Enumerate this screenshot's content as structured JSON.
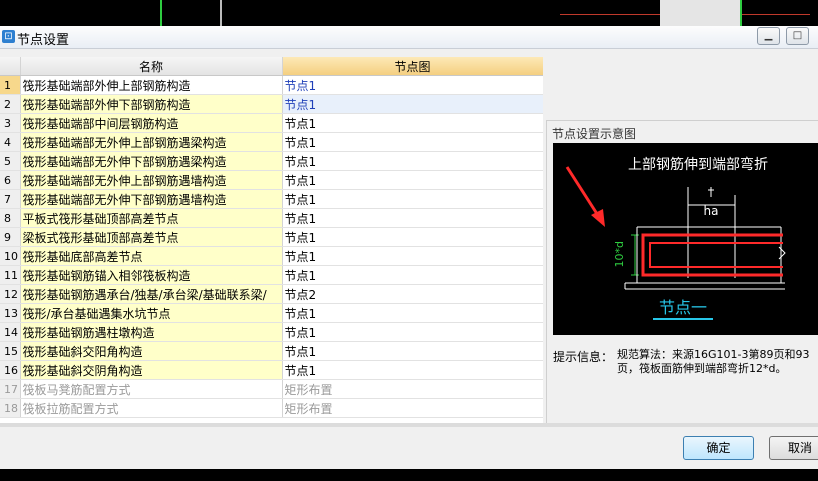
{
  "window": {
    "title": "节点设置",
    "icon": "app-icon"
  },
  "table": {
    "headers": [
      "",
      "名称",
      "节点图"
    ],
    "rows": [
      {
        "num": "1",
        "name": "筏形基础端部外伸上部钢筋构造",
        "value": "节点1"
      },
      {
        "num": "2",
        "name": "筏形基础端部外伸下部钢筋构造",
        "value": "节点1"
      },
      {
        "num": "3",
        "name": "筏形基础端部中间层钢筋构造",
        "value": "节点1"
      },
      {
        "num": "4",
        "name": "筏形基础端部无外伸上部钢筋遇梁构造",
        "value": "节点1"
      },
      {
        "num": "5",
        "name": "筏形基础端部无外伸下部钢筋遇梁构造",
        "value": "节点1"
      },
      {
        "num": "6",
        "name": "筏形基础端部无外伸上部钢筋遇墙构造",
        "value": "节点1"
      },
      {
        "num": "7",
        "name": "筏形基础端部无外伸下部钢筋遇墙构造",
        "value": "节点1"
      },
      {
        "num": "8",
        "name": "平板式筏形基础顶部高差节点",
        "value": "节点1"
      },
      {
        "num": "9",
        "name": "梁板式筏形基础顶部高差节点",
        "value": "节点1"
      },
      {
        "num": "10",
        "name": "筏形基础底部高差节点",
        "value": "节点1"
      },
      {
        "num": "11",
        "name": "筏形基础钢筋锚入相邻筏板构造",
        "value": "节点1"
      },
      {
        "num": "12",
        "name": "筏形基础钢筋遇承台/独基/承台梁/基础联系梁/",
        "value": "节点2"
      },
      {
        "num": "13",
        "name": "筏形/承台基础遇集水坑节点",
        "value": "节点1"
      },
      {
        "num": "14",
        "name": "筏形基础钢筋遇柱墩构造",
        "value": "节点1"
      },
      {
        "num": "15",
        "name": "筏形基础斜交阳角构造",
        "value": "节点1"
      },
      {
        "num": "16",
        "name": "筏形基础斜交阴角构造",
        "value": "节点1"
      },
      {
        "num": "17",
        "name": "筏板马凳筋配置方式",
        "value": "矩形布置"
      },
      {
        "num": "18",
        "name": "筏板拉筋配置方式",
        "value": "矩形布置"
      }
    ]
  },
  "preview": {
    "group_title": "节点设置示意图",
    "diagram_title": "上部钢筋伸到端部弯折",
    "dim_vertical": "10*d",
    "dim_ha": "ha",
    "node_caption": "节点一",
    "hint_label": "提示信息：",
    "hint_text": "规范算法：来源16G101-3第89页和93页，筏板面筋伸到端部弯折12*d。"
  },
  "buttons": {
    "ok": "确定",
    "cancel": "取消"
  },
  "colors": {
    "header_highlight": "#f4cf80",
    "name_cell": "#ffffc9",
    "rebar": "#ff2a2a",
    "dim": "#2ecc40",
    "caption": "#27c6e8"
  }
}
